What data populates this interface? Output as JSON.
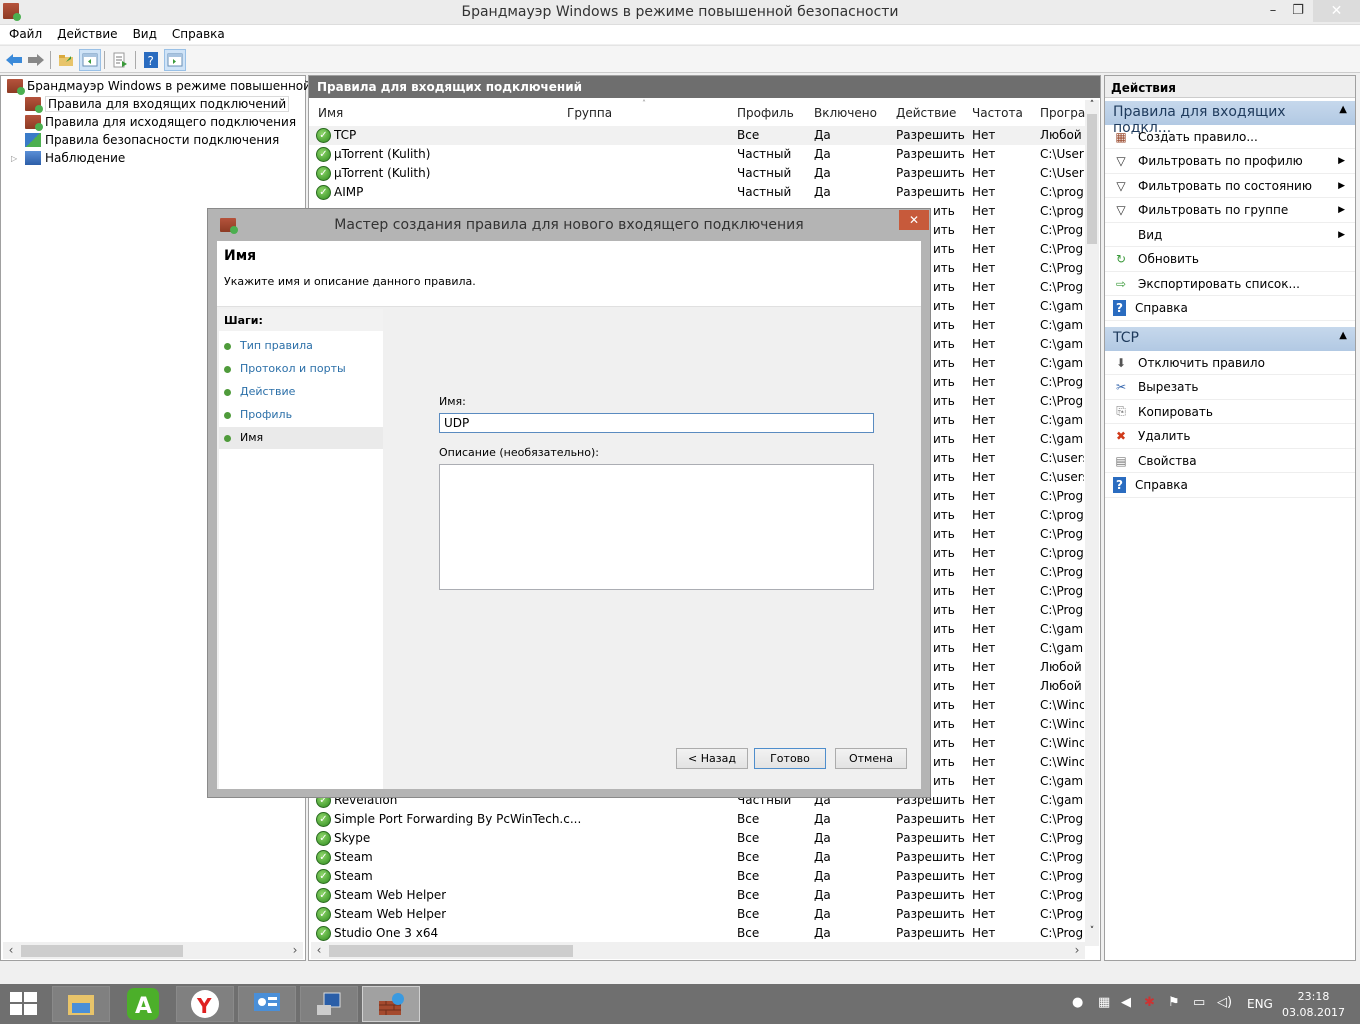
{
  "window": {
    "title": "Брандмауэр Windows в режиме повышенной безопасности",
    "minimize": "–",
    "maximize": "❐",
    "close": "✕"
  },
  "menu": [
    "Файл",
    "Действие",
    "Вид",
    "Справка"
  ],
  "toolbar": {
    "icons": [
      "back-icon",
      "forward-icon",
      "up-folder-icon",
      "show-hide-tree-icon",
      "export-list-icon",
      "help-icon",
      "show-hide-action-pane-icon"
    ]
  },
  "tree": {
    "root": "Брандмауэр Windows в режиме повышенной безопасности",
    "items": [
      {
        "label": "Правила для входящих подключений",
        "selected": true
      },
      {
        "label": "Правила для исходящего подключения",
        "selected": false
      },
      {
        "label": "Правила безопасности подключения",
        "selected": false
      },
      {
        "label": "Наблюдение",
        "selected": false,
        "expandable": true
      }
    ]
  },
  "center": {
    "header": "Правила для входящих подключений",
    "columns": [
      "Имя",
      "Группа",
      "Профиль",
      "Включено",
      "Действие",
      "Частота",
      "Програ"
    ],
    "rows_top": [
      {
        "name": "TCP",
        "group": "",
        "profile": "Все",
        "enabled": "Да",
        "action": "Разрешить",
        "override": "Нет",
        "program": "Любой",
        "selected": true
      },
      {
        "name": "µTorrent (Kulith)",
        "group": "",
        "profile": "Частный",
        "enabled": "Да",
        "action": "Разрешить",
        "override": "Нет",
        "program": "C:\\Users"
      },
      {
        "name": "µTorrent (Kulith)",
        "group": "",
        "profile": "Частный",
        "enabled": "Да",
        "action": "Разрешить",
        "override": "Нет",
        "program": "C:\\Users"
      },
      {
        "name": "AIMP",
        "group": "",
        "profile": "Частный",
        "enabled": "Да",
        "action": "Разрешить",
        "override": "Нет",
        "program": "C:\\prog"
      }
    ],
    "rows_partial": [
      {
        "action": "ить",
        "override": "Нет",
        "program": "C:\\prog"
      },
      {
        "action": "ить",
        "override": "Нет",
        "program": "C:\\Prog"
      },
      {
        "action": "ить",
        "override": "Нет",
        "program": "C:\\Prog"
      },
      {
        "action": "ить",
        "override": "Нет",
        "program": "C:\\Prog"
      },
      {
        "action": "ить",
        "override": "Нет",
        "program": "C:\\Prog"
      },
      {
        "action": "ить",
        "override": "Нет",
        "program": "C:\\gam"
      },
      {
        "action": "ить",
        "override": "Нет",
        "program": "C:\\gam"
      },
      {
        "action": "ить",
        "override": "Нет",
        "program": "C:\\gam"
      },
      {
        "action": "ить",
        "override": "Нет",
        "program": "C:\\gam"
      },
      {
        "action": "ить",
        "override": "Нет",
        "program": "C:\\Prog"
      },
      {
        "action": "ить",
        "override": "Нет",
        "program": "C:\\Prog"
      },
      {
        "action": "ить",
        "override": "Нет",
        "program": "C:\\gam"
      },
      {
        "action": "ить",
        "override": "Нет",
        "program": "C:\\gam"
      },
      {
        "action": "ить",
        "override": "Нет",
        "program": "C:\\users"
      },
      {
        "action": "ить",
        "override": "Нет",
        "program": "C:\\users"
      },
      {
        "action": "ить",
        "override": "Нет",
        "program": "C:\\Prog"
      },
      {
        "action": "ить",
        "override": "Нет",
        "program": "C:\\prog"
      },
      {
        "action": "ить",
        "override": "Нет",
        "program": "C:\\Prog"
      },
      {
        "action": "ить",
        "override": "Нет",
        "program": "C:\\prog"
      },
      {
        "action": "ить",
        "override": "Нет",
        "program": "C:\\Prog"
      },
      {
        "action": "ить",
        "override": "Нет",
        "program": "C:\\Prog"
      },
      {
        "action": "ить",
        "override": "Нет",
        "program": "C:\\Prog"
      },
      {
        "action": "ить",
        "override": "Нет",
        "program": "C:\\gam"
      },
      {
        "action": "ить",
        "override": "Нет",
        "program": "C:\\gam"
      },
      {
        "action": "ить",
        "override": "Нет",
        "program": "Любой"
      },
      {
        "action": "ить",
        "override": "Нет",
        "program": "Любой"
      },
      {
        "action": "ить",
        "override": "Нет",
        "program": "C:\\Winc"
      },
      {
        "action": "ить",
        "override": "Нет",
        "program": "C:\\Winc"
      },
      {
        "action": "ить",
        "override": "Нет",
        "program": "C:\\Winc"
      },
      {
        "action": "ить",
        "override": "Нет",
        "program": "C:\\Winc"
      },
      {
        "action": "ить",
        "override": "Нет",
        "program": "C:\\gam"
      }
    ],
    "rows_bottom": [
      {
        "name": "Revelation",
        "profile": "Частный",
        "enabled": "Да",
        "action": "Разрешить",
        "override": "Нет",
        "program": "C:\\gam"
      },
      {
        "name": "Simple Port Forwarding By PcWinTech.c...",
        "profile": "Все",
        "enabled": "Да",
        "action": "Разрешить",
        "override": "Нет",
        "program": "C:\\Prog"
      },
      {
        "name": "Skype",
        "profile": "Все",
        "enabled": "Да",
        "action": "Разрешить",
        "override": "Нет",
        "program": "C:\\Prog"
      },
      {
        "name": "Steam",
        "profile": "Все",
        "enabled": "Да",
        "action": "Разрешить",
        "override": "Нет",
        "program": "C:\\Prog"
      },
      {
        "name": "Steam",
        "profile": "Все",
        "enabled": "Да",
        "action": "Разрешить",
        "override": "Нет",
        "program": "C:\\Prog"
      },
      {
        "name": "Steam Web Helper",
        "profile": "Все",
        "enabled": "Да",
        "action": "Разрешить",
        "override": "Нет",
        "program": "C:\\Prog"
      },
      {
        "name": "Steam Web Helper",
        "profile": "Все",
        "enabled": "Да",
        "action": "Разрешить",
        "override": "Нет",
        "program": "C:\\Prog"
      },
      {
        "name": "Studio One 3 x64",
        "profile": "Все",
        "enabled": "Да",
        "action": "Разрешить",
        "override": "Нет",
        "program": "C:\\Prog"
      }
    ]
  },
  "actions": {
    "header": "Действия",
    "section1": {
      "title": "Правила для входящих подкл...",
      "items": [
        {
          "label": "Создать правило...",
          "icon": "new-rule-icon",
          "sub": false
        },
        {
          "label": "Фильтровать по профилю",
          "icon": "filter-icon",
          "sub": true
        },
        {
          "label": "Фильтровать по состоянию",
          "icon": "filter-icon",
          "sub": true
        },
        {
          "label": "Фильтровать по группе",
          "icon": "filter-icon",
          "sub": true
        },
        {
          "label": "Вид",
          "icon": "",
          "sub": true
        },
        {
          "label": "Обновить",
          "icon": "refresh-icon",
          "sub": false
        },
        {
          "label": "Экспортировать список...",
          "icon": "export-icon",
          "sub": false
        },
        {
          "label": "Справка",
          "icon": "help-icon",
          "sub": false
        }
      ]
    },
    "section2": {
      "title": "TCP",
      "items": [
        {
          "label": "Отключить правило",
          "icon": "disable-rule-icon"
        },
        {
          "label": "Вырезать",
          "icon": "cut-icon"
        },
        {
          "label": "Копировать",
          "icon": "copy-icon"
        },
        {
          "label": "Удалить",
          "icon": "delete-icon"
        },
        {
          "label": "Свойства",
          "icon": "properties-icon"
        },
        {
          "label": "Справка",
          "icon": "help-icon"
        }
      ]
    }
  },
  "dialog": {
    "title": "Мастер создания правила для нового входящего подключения",
    "close": "✕",
    "heading": "Имя",
    "subheading": "Укажите имя и описание данного правила.",
    "steps_header": "Шаги:",
    "steps": [
      {
        "label": "Тип правила",
        "current": false
      },
      {
        "label": "Протокол и порты",
        "current": false
      },
      {
        "label": "Действие",
        "current": false
      },
      {
        "label": "Профиль",
        "current": false
      },
      {
        "label": "Имя",
        "current": true
      }
    ],
    "name_label": "Имя:",
    "name_value": "UDP",
    "desc_label": "Описание (необязательно):",
    "desc_value": "",
    "back": "< Назад",
    "finish": "Готово",
    "cancel": "Отмена"
  },
  "taskbar": {
    "apps": [
      "start-button",
      "file-explorer",
      "green-a-app",
      "yandex-browser",
      "control-panel",
      "network-app",
      "firewall-app"
    ],
    "active": "firewall-app",
    "language": "ENG",
    "time": "23:18",
    "date": "03.08.2017"
  }
}
